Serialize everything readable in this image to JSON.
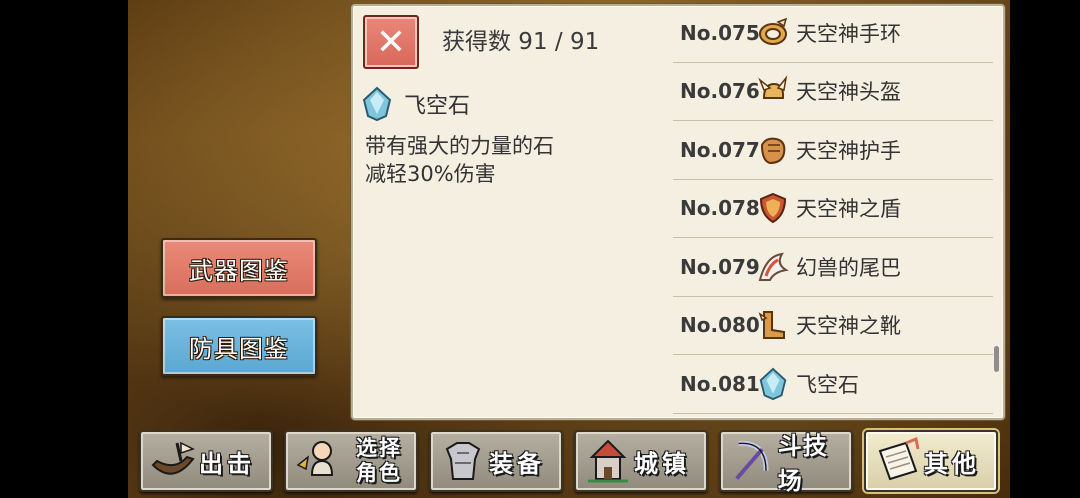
{
  "collection": {
    "count_label": "获得数 91 / 91",
    "close_symbol": "✕"
  },
  "selected_item": {
    "name": "飞空石",
    "icon": "crystal-icon",
    "description_line1": "带有强大的力量的石",
    "description_line2": "减轻30%伤害"
  },
  "sidebar": {
    "weapons_label": "武器图鉴",
    "armor_label": "防具图鉴"
  },
  "items": [
    {
      "num": "No.075",
      "name": "天空神手环",
      "icon": "bracelet-icon"
    },
    {
      "num": "No.076",
      "name": "天空神头盔",
      "icon": "winged-helmet-icon"
    },
    {
      "num": "No.077",
      "name": "天空神护手",
      "icon": "gauntlet-icon"
    },
    {
      "num": "No.078",
      "name": "天空神之盾",
      "icon": "shield-icon"
    },
    {
      "num": "No.079",
      "name": "幻兽的尾巴",
      "icon": "tail-icon"
    },
    {
      "num": "No.080",
      "name": "天空神之靴",
      "icon": "boots-icon"
    },
    {
      "num": "No.081",
      "name": "飞空石",
      "icon": "crystal-icon"
    }
  ],
  "bottom_nav": {
    "sortie": "出击",
    "select_char_line1": "选择",
    "select_char_line2": "角色",
    "equip": "装备",
    "town": "城镇",
    "arena": "斗技场",
    "other": "其他"
  }
}
